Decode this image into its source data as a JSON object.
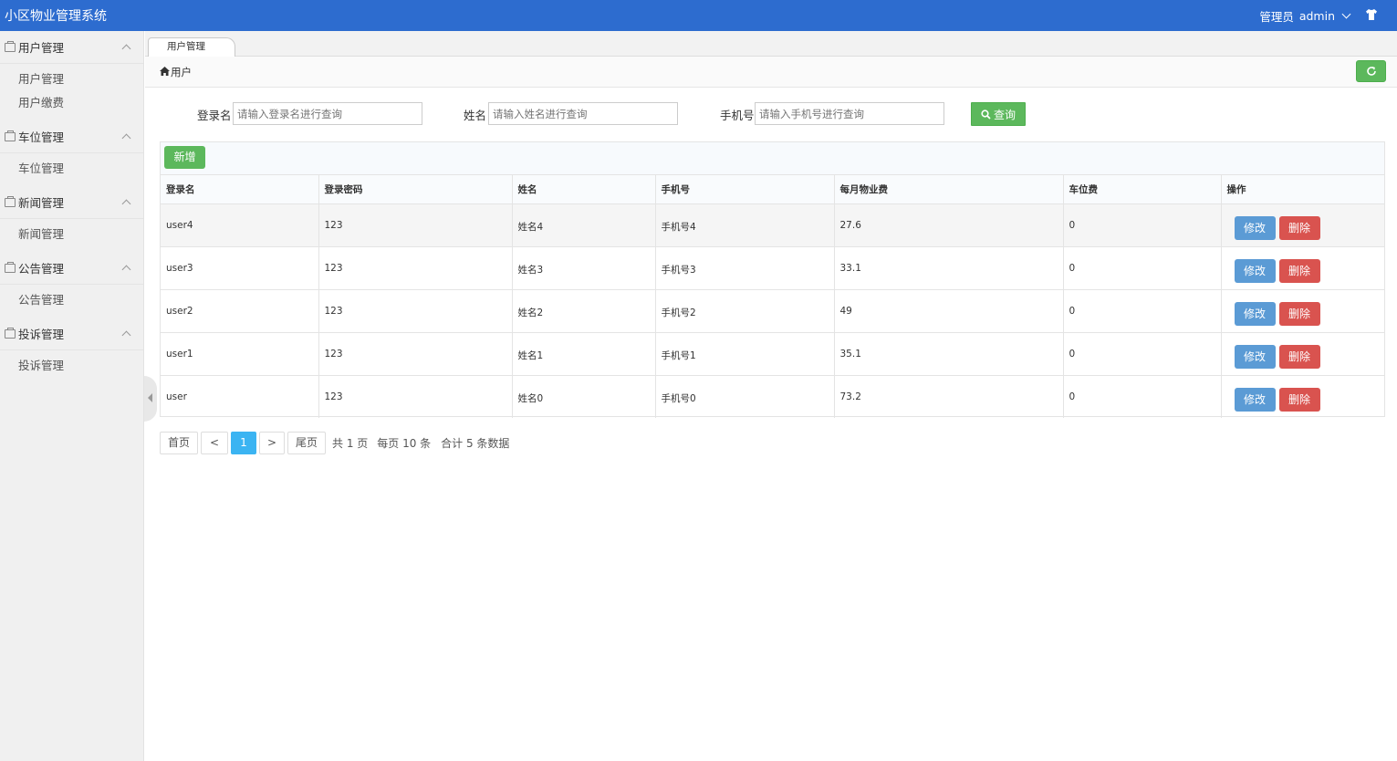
{
  "header": {
    "app_title": "小区物业管理系统",
    "role_label": "管理员",
    "username": "admin",
    "theme_icon": "shirt-icon"
  },
  "sidebar": {
    "groups": [
      {
        "label": "用户管理",
        "items": [
          "用户管理",
          "用户缴费"
        ]
      },
      {
        "label": "车位管理",
        "items": [
          "车位管理"
        ]
      },
      {
        "label": "新闻管理",
        "items": [
          "新闻管理"
        ]
      },
      {
        "label": "公告管理",
        "items": [
          "公告管理"
        ]
      },
      {
        "label": "投诉管理",
        "items": [
          "投诉管理"
        ]
      }
    ]
  },
  "tabs": [
    {
      "label": "用户管理"
    }
  ],
  "breadcrumb": {
    "label": "用户"
  },
  "search": {
    "login_label": "登录名",
    "login_placeholder": "请输入登录名进行查询",
    "name_label": "姓名",
    "name_placeholder": "请输入姓名进行查询",
    "phone_label": "手机号",
    "phone_placeholder": "请输入手机号进行查询",
    "query_label": "查询"
  },
  "toolbar": {
    "add_label": "新增"
  },
  "table": {
    "columns": [
      "登录名",
      "登录密码",
      "姓名",
      "手机号",
      "每月物业费",
      "车位费",
      "操作"
    ],
    "rows": [
      [
        "user4",
        "123",
        "姓名4",
        "手机号4",
        "27.6",
        "0"
      ],
      [
        "user3",
        "123",
        "姓名3",
        "手机号3",
        "33.1",
        "0"
      ],
      [
        "user2",
        "123",
        "姓名2",
        "手机号2",
        "49",
        "0"
      ],
      [
        "user1",
        "123",
        "姓名1",
        "手机号1",
        "35.1",
        "0"
      ],
      [
        "user",
        "123",
        "姓名0",
        "手机号0",
        "73.2",
        "0"
      ]
    ],
    "edit_label": "修改",
    "delete_label": "删除"
  },
  "pager": {
    "first": "首页",
    "prev": "<",
    "current": "1",
    "next": ">",
    "last": "尾页",
    "total_pages": "共 1 页",
    "per_page": "每页 10 条",
    "total_records": "合计 5 条数据"
  },
  "colors": {
    "header_bg": "#2d6ccf",
    "success": "#5cb85c",
    "edit": "#5b9bd5",
    "danger": "#d9534f",
    "pager_active": "#3bb4f2"
  }
}
